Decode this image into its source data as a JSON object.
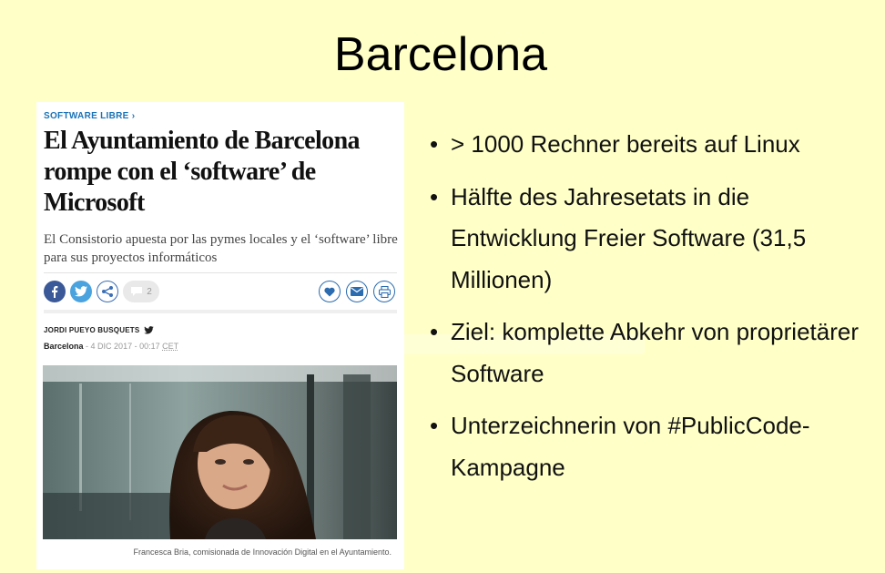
{
  "slide": {
    "title": "Barcelona"
  },
  "article": {
    "kicker": "SOFTWARE LIBRE",
    "kicker_arrow": "›",
    "headline": "El Ayuntamiento de Barcelona rompe con el ‘software’ de Microsoft",
    "subhead": "El Consistorio apuesta por las pymes locales y el ‘software’ libre para sus proyectos informáticos",
    "comment_count": "2",
    "author": "JORDI PUEYO BUSQUETS",
    "place": "Barcelona",
    "date": "4 DIC 2017 - 00:17",
    "timezone": "CET",
    "caption": "Francesca Bria, comisionada de Innovación Digital en el Ayuntamiento."
  },
  "bullets": [
    "> 1000 Rechner bereits auf Linux",
    "Hälfte des Jahresetats in die Entwicklung Freier Software (31,5 Millionen)",
    "Ziel: komplette Abkehr von proprietärer Software",
    "Unterzeichnerin von #PublicCode-Kampagne"
  ],
  "colors": {
    "background": "#ffffc8",
    "kicker": "#1a73b8",
    "facebook": "#3b5998",
    "twitter": "#4aa3df"
  },
  "icons": [
    "facebook-icon",
    "twitter-icon",
    "share-icon",
    "comment-icon",
    "heart-icon",
    "mail-icon",
    "print-icon",
    "twitter-bird-icon"
  ]
}
